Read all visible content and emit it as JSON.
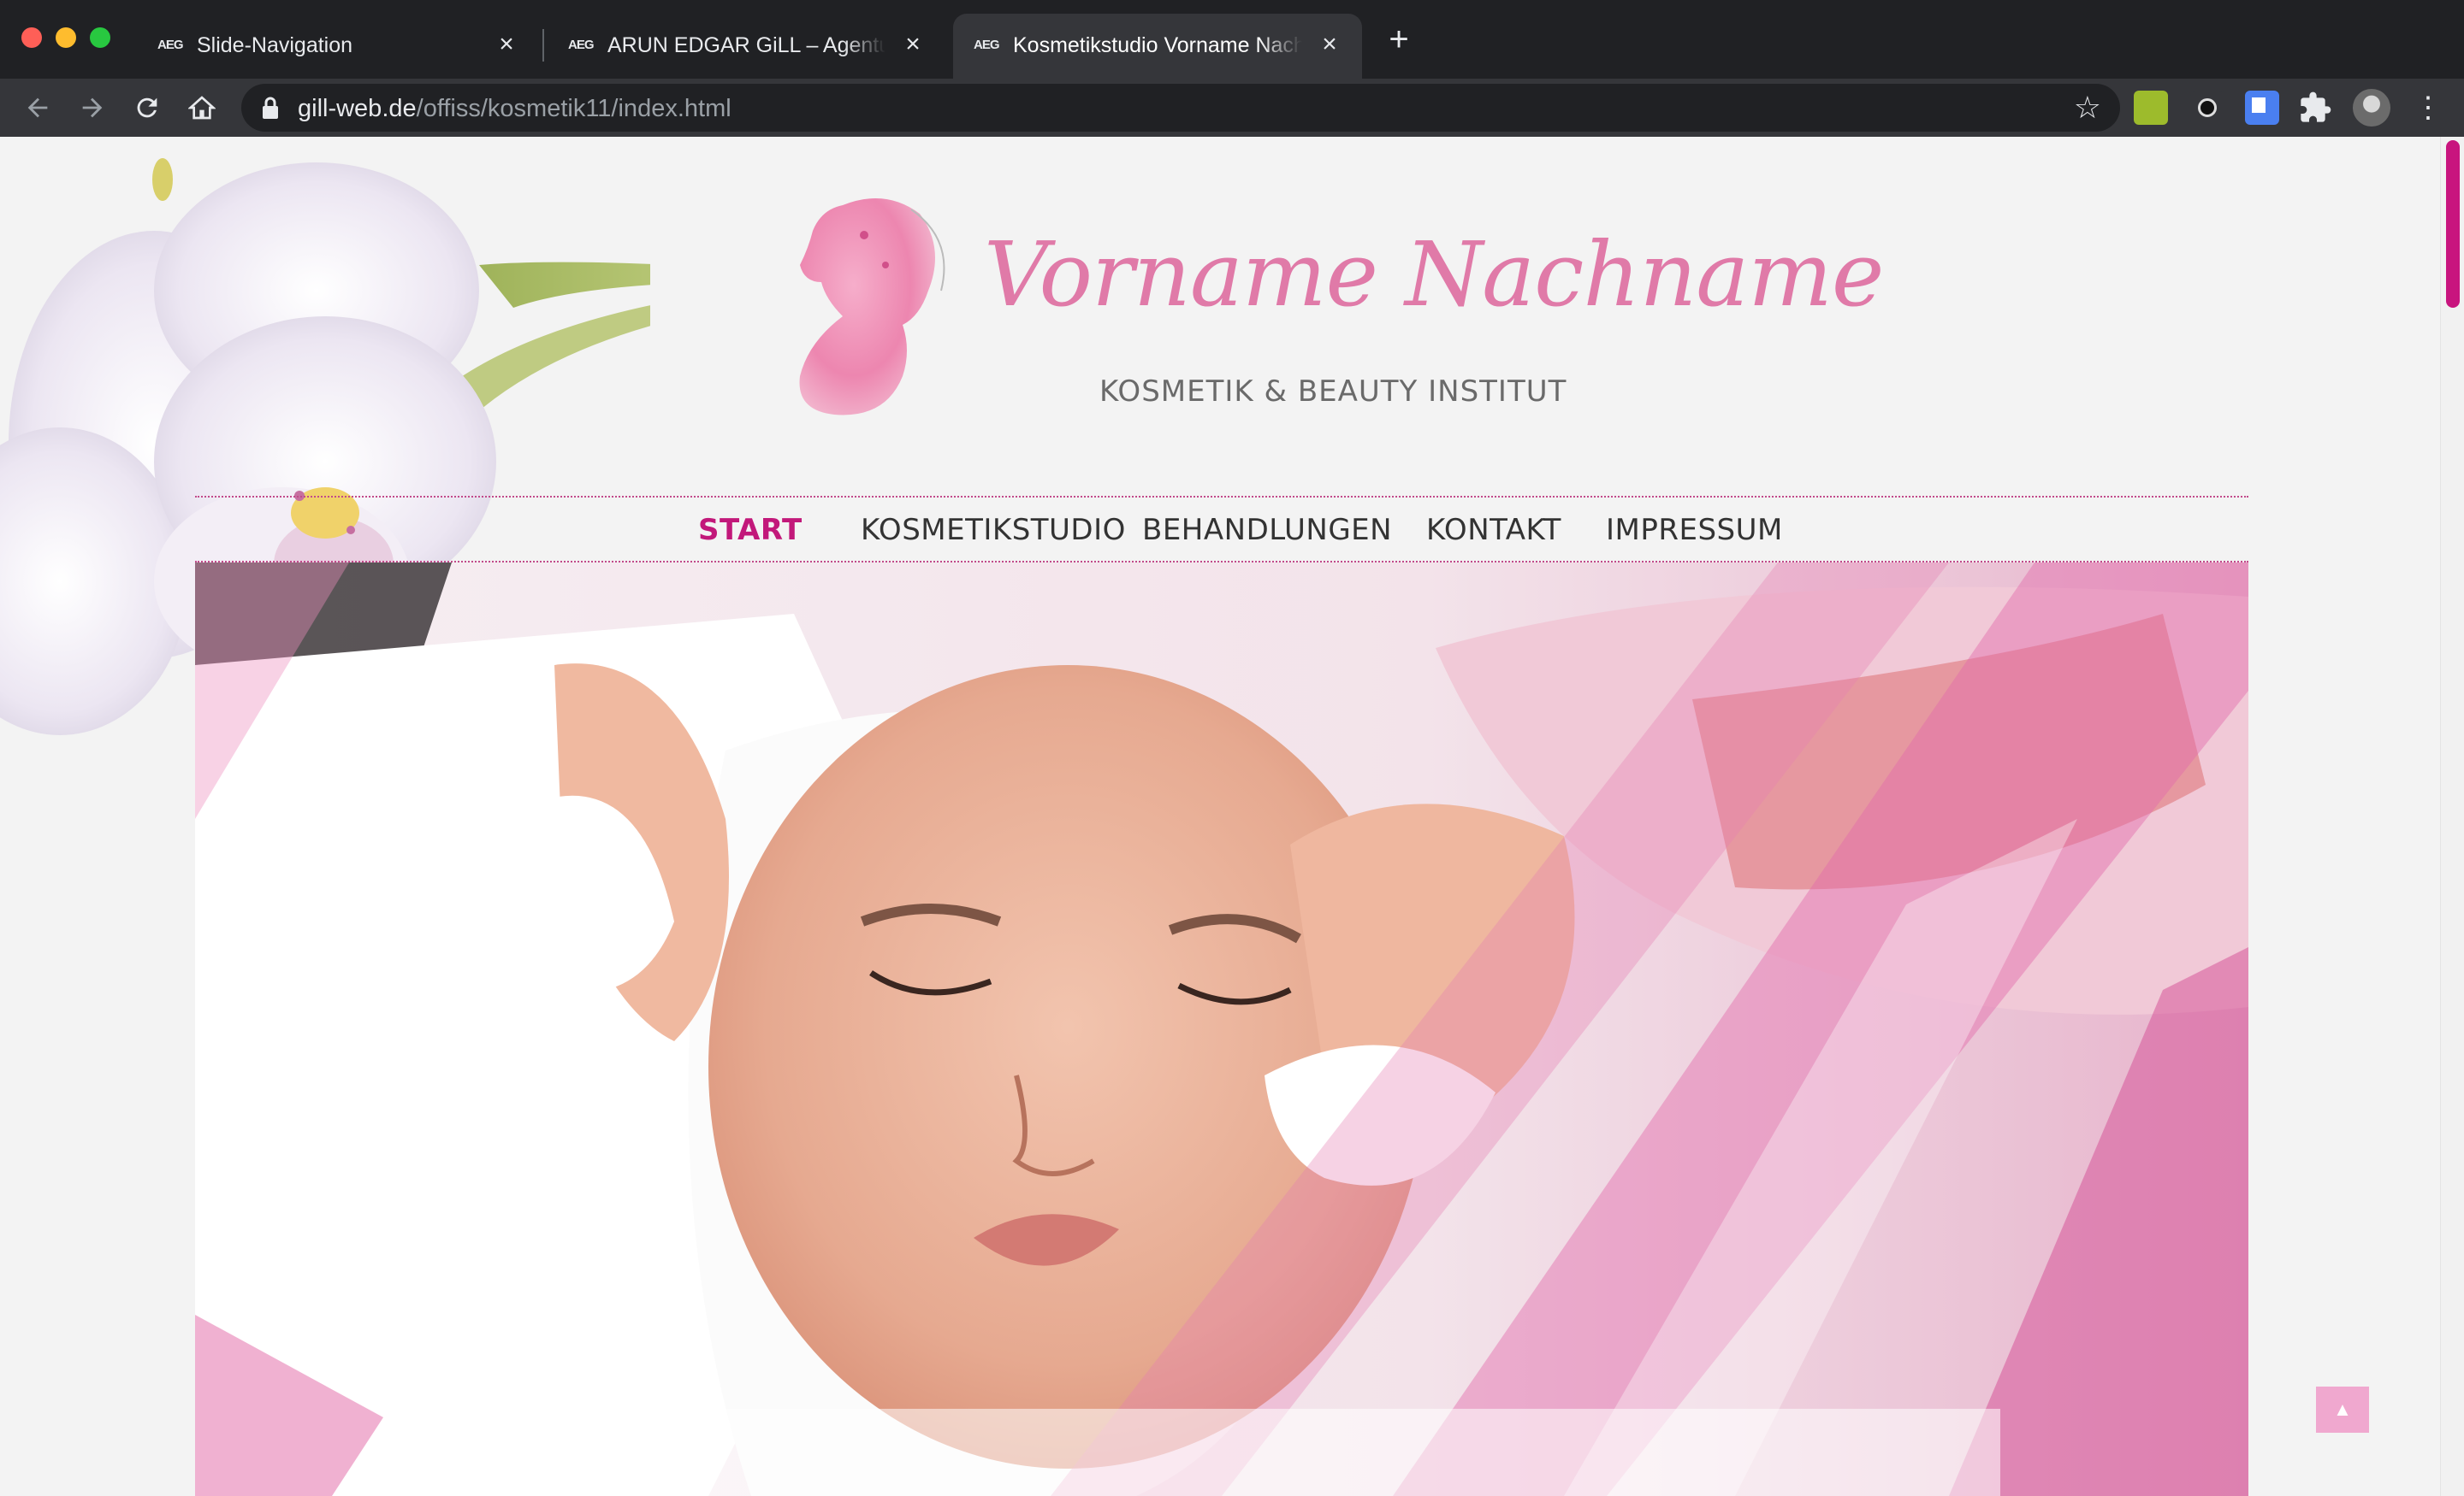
{
  "browser": {
    "tabs": [
      {
        "favicon": "AEG",
        "title": "Slide-Navigation",
        "active": false
      },
      {
        "favicon": "AEG",
        "title": "ARUN EDGAR GiLL – Agentur f",
        "active": false
      },
      {
        "favicon": "AEG",
        "title": "Kosmetikstudio Vorname Nach",
        "active": true
      }
    ],
    "new_tab_label": "+",
    "url_host": "gill-web.de",
    "url_path": "/offiss/kosmetik11/index.html",
    "icons": {
      "back": "arrow-left-icon",
      "forward": "arrow-right-icon",
      "reload": "reload-icon",
      "home": "home-icon",
      "lock": "lock-icon",
      "bookmark": "star-icon",
      "extensions": "puzzle-icon",
      "menu": "kebab-menu-icon"
    }
  },
  "site": {
    "brand_name": "Vorname Nachname",
    "brand_subtitle": "KOSMETIK & BEAUTY INSTITUT",
    "nav": [
      {
        "label": "START",
        "active": true
      },
      {
        "label": "KOSMETIKSTUDIO",
        "active": false
      },
      {
        "label": "BEHANDLUNGEN",
        "active": false
      },
      {
        "label": "KONTAKT",
        "active": false
      },
      {
        "label": "IMPRESSUM",
        "active": false
      }
    ],
    "accent_color": "#c2187a",
    "to_top_label": "▲"
  }
}
